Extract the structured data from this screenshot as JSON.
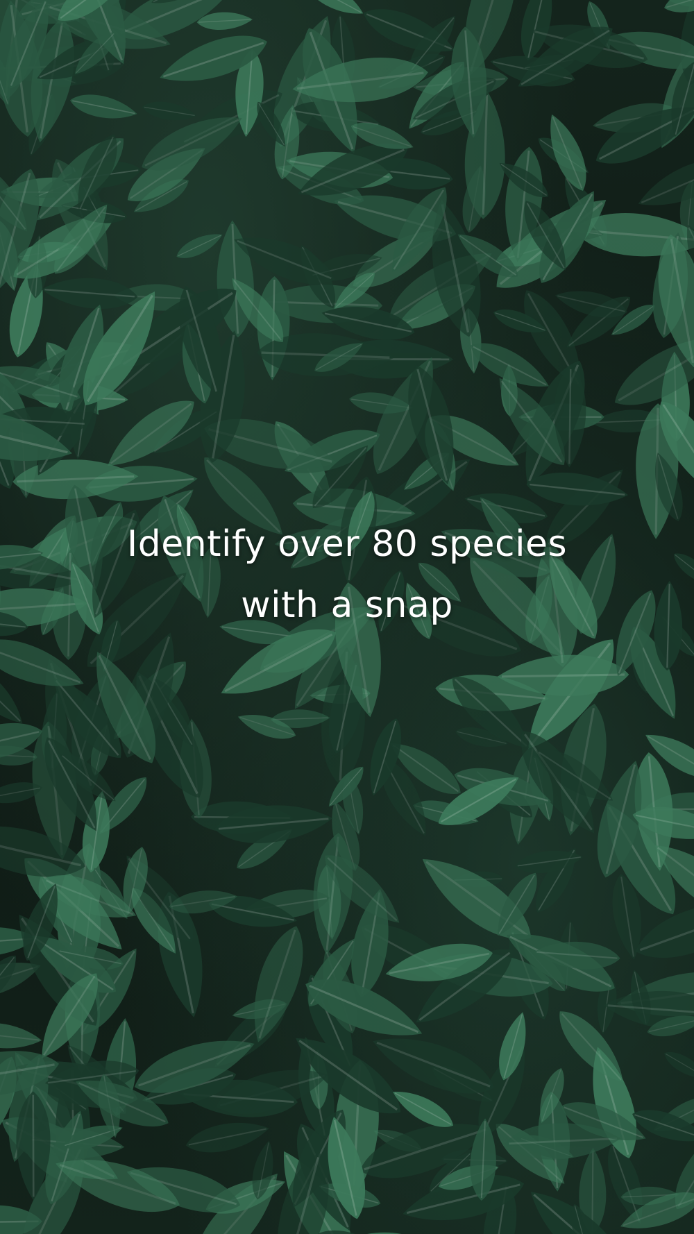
{
  "onboarding": {
    "headline_line1": "Identify over 80 species",
    "headline_line2": "with a snap",
    "background_image": "leaf-foliage-background",
    "colors": {
      "background": "#0f1a15",
      "leaf_light": "#3d7a5b",
      "leaf_mid": "#2b5a43",
      "leaf_dark": "#1a3a2b",
      "text": "#ffffff"
    }
  }
}
